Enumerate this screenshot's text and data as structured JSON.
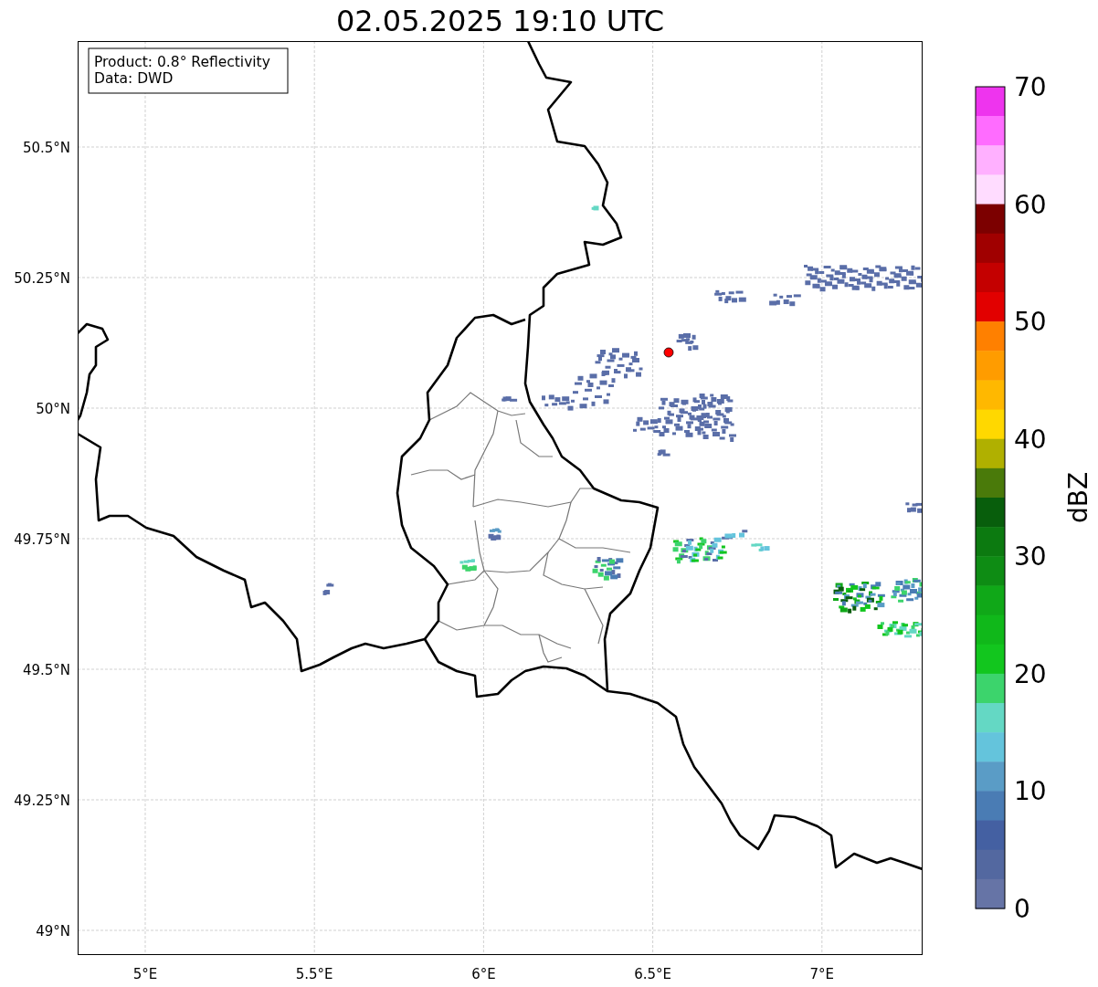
{
  "title": "02.05.2025 19:10 UTC",
  "info_box": {
    "lines": [
      "Product: 0.8° Reflectivity",
      "Data: DWD"
    ]
  },
  "map": {
    "lat_ticks": [
      "50.5°N",
      "50.25°N",
      "50°N",
      "49.75°N",
      "49.5°N",
      "49.25°N",
      "49°N"
    ],
    "lon_ticks": [
      "5°E",
      "5.5°E",
      "6°E",
      "6.5°E",
      "7°E"
    ]
  },
  "colorbar": {
    "label": "dBZ",
    "ticks": [
      "70",
      "60",
      "50",
      "40",
      "30",
      "20",
      "10",
      "0"
    ],
    "segments": [
      {
        "color": "#ee34ee"
      },
      {
        "color": "#ff6cff"
      },
      {
        "color": "#ffb0ff"
      },
      {
        "color": "#ffdcff"
      },
      {
        "color": "#7c0000"
      },
      {
        "color": "#a00000"
      },
      {
        "color": "#c40000"
      },
      {
        "color": "#e20000"
      },
      {
        "color": "#ff8000"
      },
      {
        "color": "#ff9c00"
      },
      {
        "color": "#ffb800"
      },
      {
        "color": "#ffd800"
      },
      {
        "color": "#b0b000"
      },
      {
        "color": "#4a7a0a"
      },
      {
        "color": "#085e0c"
      },
      {
        "color": "#0c7a10"
      },
      {
        "color": "#0e8c14"
      },
      {
        "color": "#10a818"
      },
      {
        "color": "#10b81a"
      },
      {
        "color": "#12c61e"
      },
      {
        "color": "#3cd46c"
      },
      {
        "color": "#64d8c4"
      },
      {
        "color": "#64c4dc"
      },
      {
        "color": "#5a9cc6"
      },
      {
        "color": "#4a7cb4"
      },
      {
        "color": "#4460a2"
      },
      {
        "color": "#5368a0"
      },
      {
        "color": "#6674a6"
      }
    ]
  }
}
